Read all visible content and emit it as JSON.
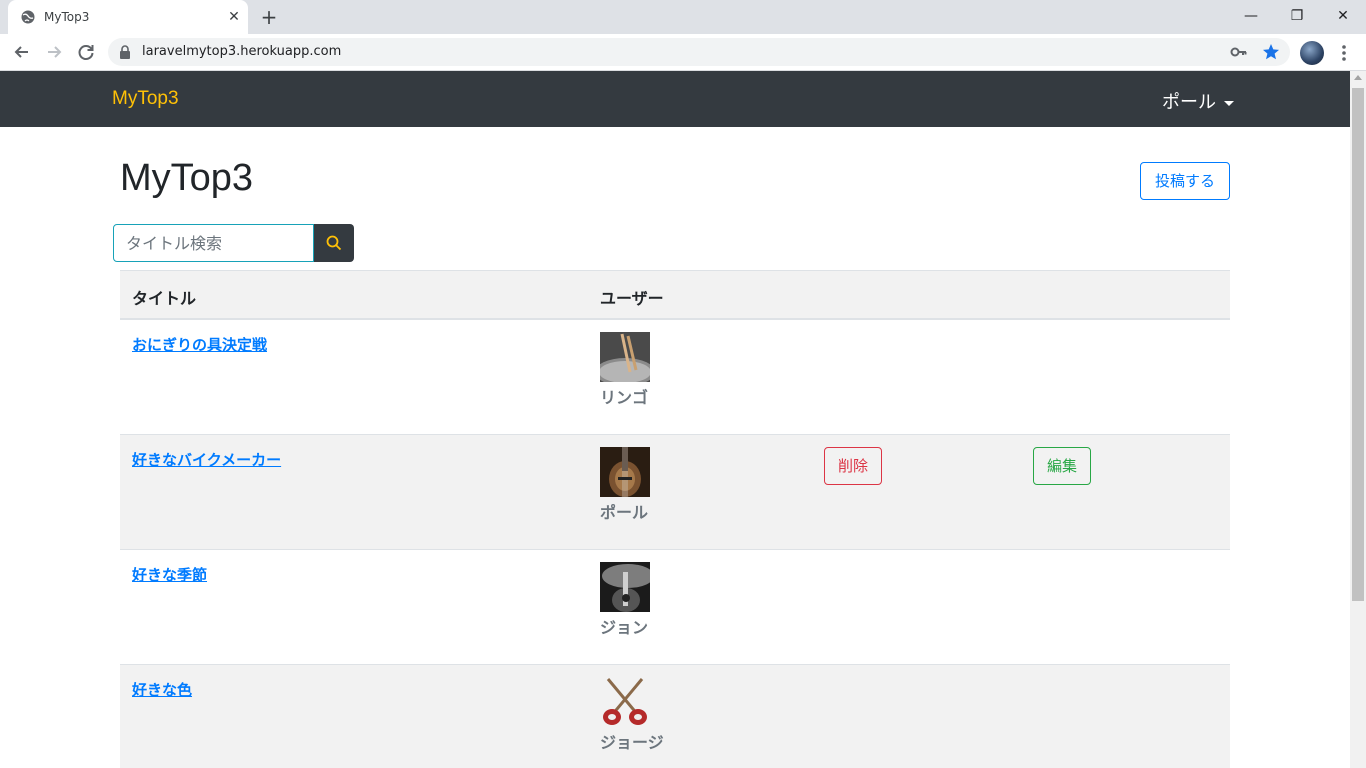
{
  "browser": {
    "tab_title": "MyTop3",
    "url": "laravelmytop3.herokuapp.com",
    "close_glyph": "✕",
    "new_tab_glyph": "+",
    "minimize_glyph": "—",
    "maximize_glyph": "❐",
    "window_close_glyph": "✕"
  },
  "navbar": {
    "brand": "MyTop3",
    "user": "ポール",
    "brand_color": "#ffc107",
    "bg_color": "#343a40"
  },
  "main": {
    "title": "MyTop3",
    "post_button": "投稿する",
    "search_placeholder": "タイトル検索"
  },
  "table": {
    "headers": {
      "title": "タイトル",
      "user": "ユーザー"
    },
    "rows": [
      {
        "title": "おにぎりの具決定戦",
        "user": "リンゴ",
        "avatar_icon": "drumsticks-image"
      },
      {
        "title": "好きなバイクメーカー",
        "user": "ポール",
        "avatar_icon": "bass-guitar-image",
        "delete_label": "削除",
        "edit_label": "編集"
      },
      {
        "title": "好きな季節",
        "user": "ジョン",
        "avatar_icon": "guitar-image"
      },
      {
        "title": "好きな色",
        "user": "ジョージ",
        "avatar_icon": "crossed-guitars-image"
      }
    ]
  }
}
